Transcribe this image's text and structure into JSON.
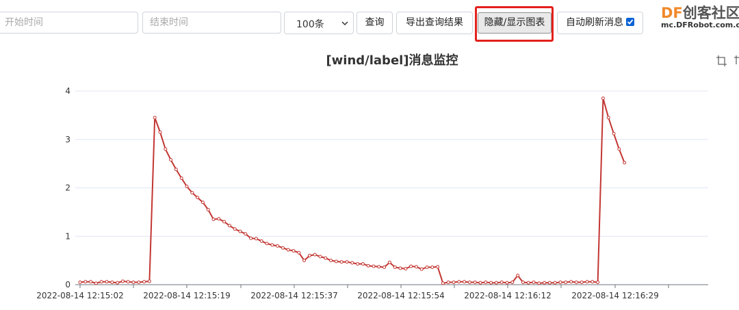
{
  "toolbar": {
    "start_placeholder": "开始时间",
    "end_placeholder": "结束时间",
    "limit_value": "100条",
    "query_label": "查询",
    "export_label": "导出查询结果",
    "toggle_chart_label": "隐藏/显示图表",
    "auto_refresh_label": "自动刷新消息"
  },
  "logo": {
    "df": "DF",
    "cn": "创客社区",
    "domain": "mc.DFRobot.com.cn"
  },
  "colors": {
    "series": "#c23531",
    "highlight": "#e3211c",
    "checkbox": "#0b63d6"
  },
  "icons": {
    "crop": "crop-icon",
    "chevron": "chevron-down-icon",
    "check": "check-icon"
  },
  "chart_data": {
    "type": "line",
    "title": "[wind/label]消息监控",
    "ylim": [
      0,
      4
    ],
    "y_ticks": [
      "0",
      "1",
      "2",
      "3",
      "4"
    ],
    "x_tick_labels": [
      "2022-08-14 12:15:02",
      "2022-08-14 12:15:19",
      "2022-08-14 12:15:37",
      "2022-08-14 12:15:54",
      "2022-08-14 12:16:12",
      "2022-08-14 12:16:29"
    ],
    "grid": true,
    "series": [
      {
        "values": [
          0.05,
          0.06,
          0.06,
          0.03,
          0.06,
          0.06,
          0.05,
          0.04,
          0.07,
          0.06,
          0.05,
          0.05,
          0.06,
          0.07,
          3.45,
          3.15,
          2.8,
          2.58,
          2.38,
          2.2,
          2.03,
          1.9,
          1.8,
          1.7,
          1.55,
          1.35,
          1.36,
          1.3,
          1.22,
          1.15,
          1.1,
          1.05,
          0.96,
          0.95,
          0.9,
          0.85,
          0.82,
          0.8,
          0.76,
          0.72,
          0.7,
          0.66,
          0.5,
          0.6,
          0.62,
          0.58,
          0.55,
          0.5,
          0.48,
          0.47,
          0.47,
          0.45,
          0.43,
          0.43,
          0.39,
          0.38,
          0.37,
          0.36,
          0.46,
          0.36,
          0.34,
          0.33,
          0.38,
          0.37,
          0.32,
          0.36,
          0.36,
          0.37,
          0.03,
          0.05,
          0.05,
          0.06,
          0.06,
          0.05,
          0.05,
          0.04,
          0.05,
          0.04,
          0.04,
          0.05,
          0.04,
          0.05,
          0.19,
          0.05,
          0.04,
          0.05,
          0.03,
          0.04,
          0.04,
          0.04,
          0.05,
          0.05,
          0.06,
          0.05,
          0.05,
          0.06,
          0.06,
          0.05,
          3.85,
          3.45,
          3.12,
          2.8,
          2.52
        ]
      }
    ]
  }
}
